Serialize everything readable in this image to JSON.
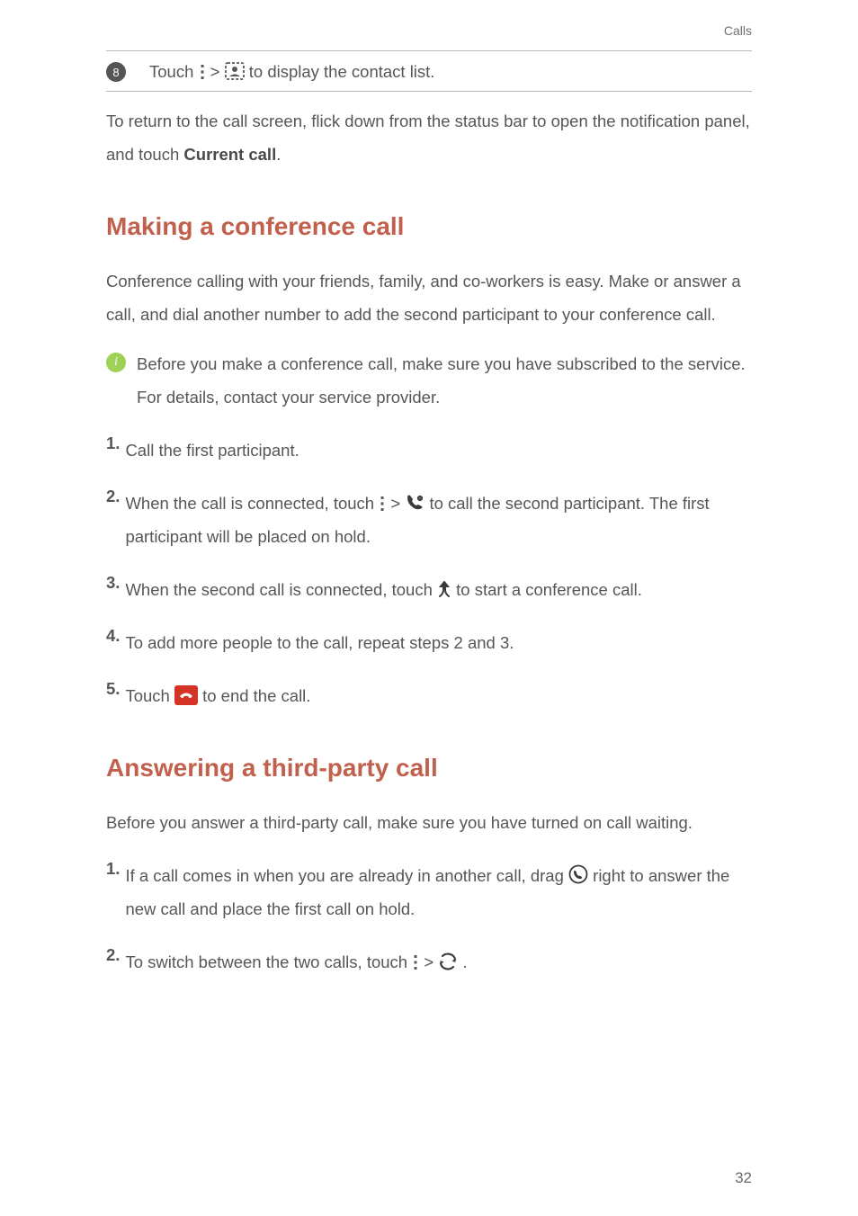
{
  "header": {
    "section": "Calls"
  },
  "row8": {
    "num": "8",
    "pre": "Touch ",
    "mid": " > ",
    "post": " to display the contact list."
  },
  "return_para": {
    "line1": "To return to the call screen, flick down from the status bar to open the ",
    "line2_pre": "notification panel, and touch ",
    "bold": "Current call",
    "line2_post": "."
  },
  "h2a": "Making a conference call",
  "conf_intro": "Conference calling with your friends, family, and co-workers is easy. Make or answer a call, and dial another number to add the second participant to your conference call.",
  "conf_info": "Before you make a conference call, make sure you have subscribed to the service. For details, contact your service provider.",
  "steps_a": {
    "s1": {
      "n": "1.",
      "t": "Call the first participant."
    },
    "s2": {
      "n": "2.",
      "pre": "When the call is connected, touch ",
      "mid": " > ",
      "post": " to call the second participant. The first participant will be placed on hold."
    },
    "s3": {
      "n": "3.",
      "pre": "When the second call is connected, touch ",
      "post": " to start a conference call."
    },
    "s4": {
      "n": "4.",
      "t": "To add more people to the call, repeat steps 2 and 3."
    },
    "s5": {
      "n": "5.",
      "pre": "Touch ",
      "post": " to end the call."
    }
  },
  "h2b": "Answering a third-party call",
  "third_intro": "Before you answer a third-party call, make sure you have turned on call waiting.",
  "steps_b": {
    "s1": {
      "n": "1.",
      "pre": "If a call comes in when you are already in another call, drag ",
      "post": " right to answer the new call and place the first call on hold."
    },
    "s2": {
      "n": "2.",
      "pre": "To switch between the two calls, touch ",
      "mid": " > ",
      "post": " ."
    }
  },
  "pagenum": "32"
}
